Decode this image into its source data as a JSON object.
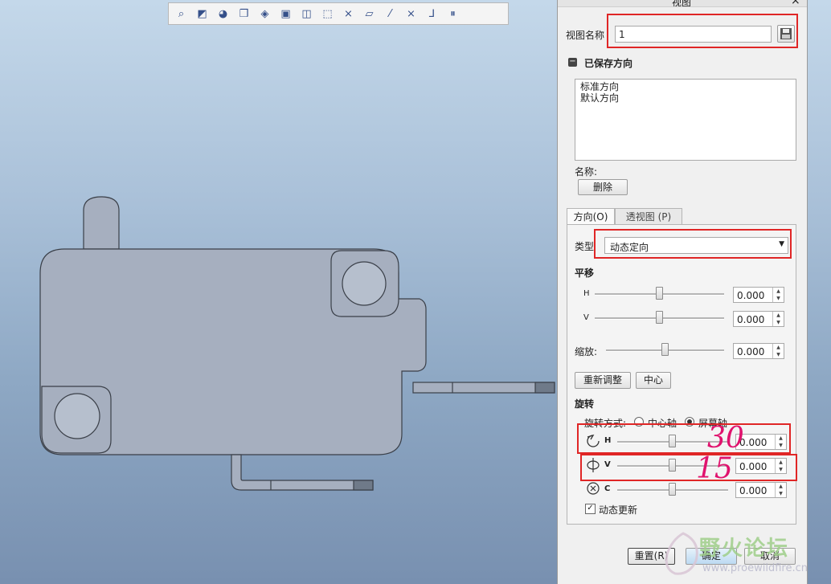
{
  "toolbar": {
    "icons": [
      "zoom-icon",
      "refit-icon",
      "shading-icon",
      "display-style-icon",
      "named-view-icon",
      "saved-view-icon",
      "view-manager-icon",
      "plane-display-icon",
      "axis-display-icon",
      "point-display-icon",
      "csys-display-icon",
      "annotation-icon",
      "spin-center-icon",
      "pause-icon"
    ],
    "glyphs": [
      "⌕",
      "◩",
      "◕",
      "❒",
      "◈",
      "▣",
      "◫",
      "⬚",
      "⨯",
      "▱",
      "⁄",
      "⨯",
      "⅃",
      "⏸"
    ]
  },
  "dialog": {
    "title": "视图",
    "close": "×",
    "view_name_label": "视图名称",
    "view_name_value": "1",
    "saved_section": "已保存方向",
    "saved_list": [
      "标准方向",
      "默认方向"
    ],
    "name_label": "名称:",
    "delete_button": "删除",
    "tabs": [
      "方向(O)",
      "透视图 (P)"
    ],
    "type_label": "类型",
    "type_value": "动态定向",
    "pan_title": "平移",
    "pan_h_label": "H",
    "pan_v_label": "V",
    "zoom_label": "缩放:",
    "pan_h_value": "0.000",
    "pan_v_value": "0.000",
    "zoom_value": "0.000",
    "readjust_button": "重新调整",
    "center_button": "中心",
    "rotate_title": "旋转",
    "rotate_mode_label": "旋转方式:",
    "rotate_mode_center": "中心轴",
    "rotate_mode_screen": "屏幕轴",
    "rot_h_label": "H",
    "rot_v_label": "V",
    "rot_c_label": "C",
    "rot_h_value": "0.000",
    "rot_v_value": "0.000",
    "rot_c_value": "0.000",
    "dynamic_update": "动态更新",
    "reset_button": "重置(R)",
    "ok_button": "确定",
    "cancel_button": "取消"
  },
  "annotations": {
    "h_note": "30",
    "v_note": "15"
  },
  "watermark": {
    "title": "野火论坛",
    "url": "www.proewildfire.cn"
  }
}
